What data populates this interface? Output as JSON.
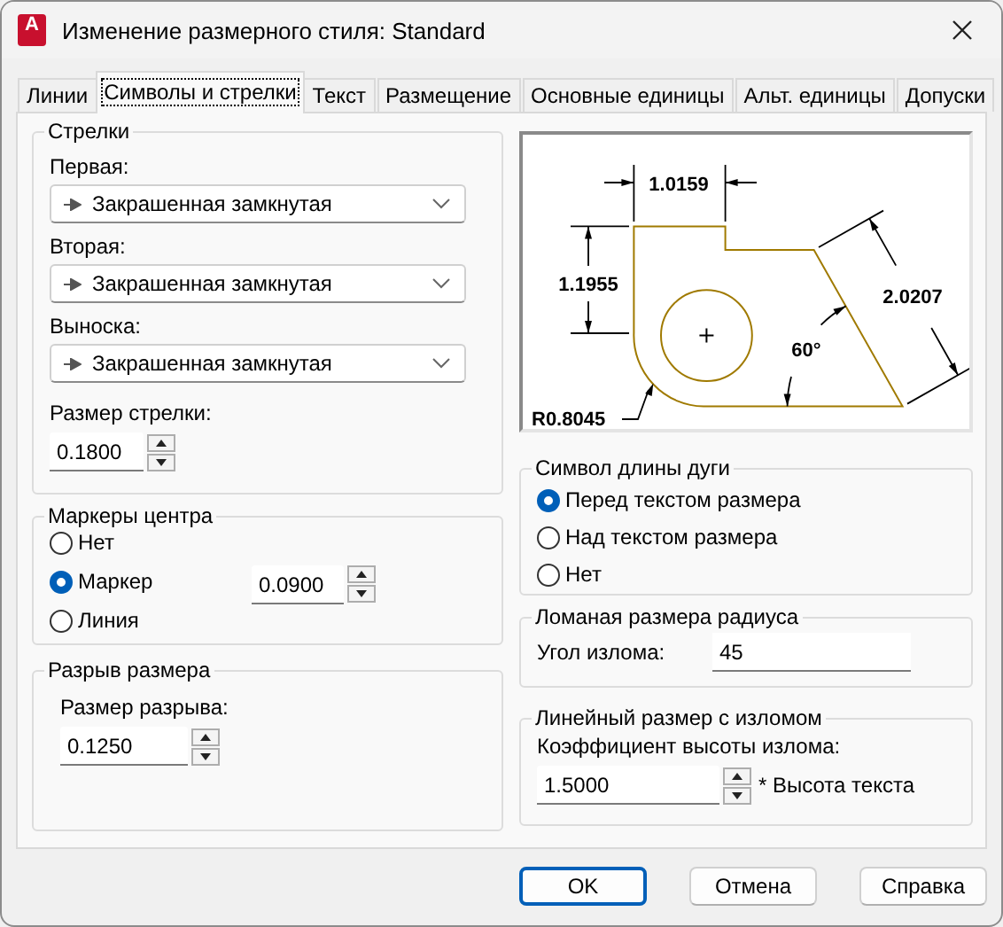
{
  "window": {
    "title": "Изменение размерного стиля: Standard",
    "icon_label": "A"
  },
  "tabs": [
    {
      "label": "Линии",
      "selected": false
    },
    {
      "label": "Символы и стрелки",
      "selected": true
    },
    {
      "label": "Текст",
      "selected": false
    },
    {
      "label": "Размещение",
      "selected": false
    },
    {
      "label": "Основные единицы",
      "selected": false
    },
    {
      "label": "Альт. единицы",
      "selected": false
    },
    {
      "label": "Допуски",
      "selected": false
    }
  ],
  "arrowheads": {
    "title": "Стрелки",
    "fields": [
      {
        "label": "Первая:",
        "value": "Закрашенная замкнутая"
      },
      {
        "label": "Вторая:",
        "value": "Закрашенная замкнутая"
      },
      {
        "label": "Выноска:",
        "value": "Закрашенная замкнутая"
      }
    ],
    "size": {
      "label": "Размер стрелки:",
      "value": "0.1800"
    }
  },
  "center_marks": {
    "title": "Маркеры центра",
    "options": [
      {
        "label": "Нет",
        "selected": false
      },
      {
        "label": "Маркер",
        "selected": true
      },
      {
        "label": "Линия",
        "selected": false
      }
    ],
    "size": {
      "value": "0.0900"
    }
  },
  "dimension_break": {
    "title": "Разрыв размера",
    "size": {
      "label": "Размер разрыва:",
      "value": "0.1250"
    }
  },
  "preview": {
    "labels": [
      "1.0159",
      "1.1955",
      "2.0207",
      "60°",
      "R0.8045"
    ]
  },
  "arc_length_symbol": {
    "title": "Символ длины дуги",
    "options": [
      {
        "label": "Перед текстом размера",
        "selected": true
      },
      {
        "label": "Над текстом размера",
        "selected": false
      },
      {
        "label": "Нет",
        "selected": false
      }
    ]
  },
  "radius_jog": {
    "title": "Ломаная размера радиуса",
    "angle": {
      "label": "Угол излома:",
      "value": "45"
    }
  },
  "linear_jog": {
    "title": "Линейный размер с изломом",
    "factor": {
      "label": "Коэффициент высоты излома:",
      "value": "1.5000",
      "suffix": "* Высота текста"
    }
  },
  "buttons": [
    {
      "label": "OK",
      "default": true
    },
    {
      "label": "Отмена",
      "default": false
    },
    {
      "label": "Справка",
      "default": false
    }
  ]
}
